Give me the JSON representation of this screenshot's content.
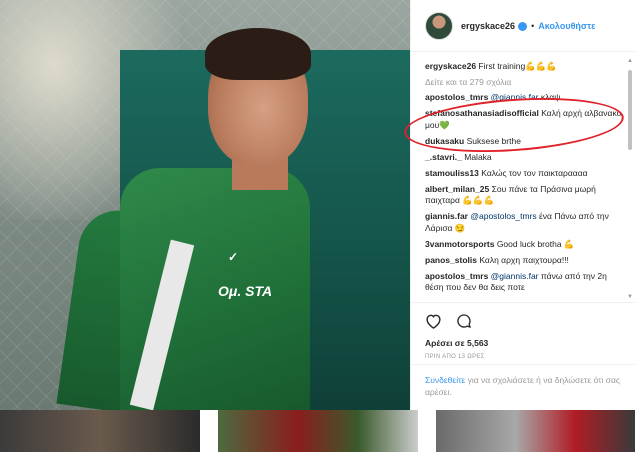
{
  "post": {
    "username": "ergyskace26",
    "follow_label": "Ακολουθήστε",
    "separator": "•",
    "photo_logo": "STA",
    "photo_logo_prefix": "Ομ."
  },
  "comments": {
    "items": [
      {
        "user": "ergyskace26",
        "text": "First training",
        "emoji": "💪💪💪"
      },
      {
        "more": "Δείτε και τα 279 σχόλια"
      },
      {
        "user": "apostolos_tmrs",
        "mention": "@giannis.far",
        "text": "κλαψ"
      },
      {
        "user": "stefanosathanasiadisofficial",
        "text": "Καλή αρχή αλβανακο μου",
        "emoji": "💚"
      },
      {
        "user": "dukasaku",
        "text": "Suksese brthe"
      },
      {
        "user": "_.stavri._",
        "text": "Malaka"
      },
      {
        "user": "stamouliss13",
        "text": "Καλώς τον τον παικταραααα"
      },
      {
        "user": "albert_milan_25",
        "text": "Σου πάνε τα Πράσινα μωρή παιχταρα",
        "emoji": "💪💪💪"
      },
      {
        "user": "giannis.far",
        "mention": "@apostolos_tmrs",
        "text": "ένα Πάνω από την Λάρισα",
        "emoji": "😏"
      },
      {
        "user": "3vanmotorsports",
        "text": "Good luck brotha",
        "emoji": "💪"
      },
      {
        "user": "panos_stolis",
        "text": "Καλη αρχη παιχτουρα!!!"
      },
      {
        "user": "apostolos_tmrs",
        "mention": "@giannis.far",
        "text": "πάνω από την 2η θέση που δεν θα δεις ποτε"
      }
    ]
  },
  "actions": {
    "likes": "Αρέσει σε 5,563",
    "time": "ΠΡΙΝ ΑΠΟ 13 ΩΡΕΣ",
    "like_icon": "heart-icon",
    "comment_icon": "comment-bubble-icon"
  },
  "login": {
    "link": "Συνδεθείτε",
    "text": " για να σχολιάσετε ή να δηλώσετε ότι σας αρέσει."
  },
  "colors": {
    "accent": "#3897f0",
    "highlight": "#e0222a",
    "jersey": "#1f6e38"
  }
}
